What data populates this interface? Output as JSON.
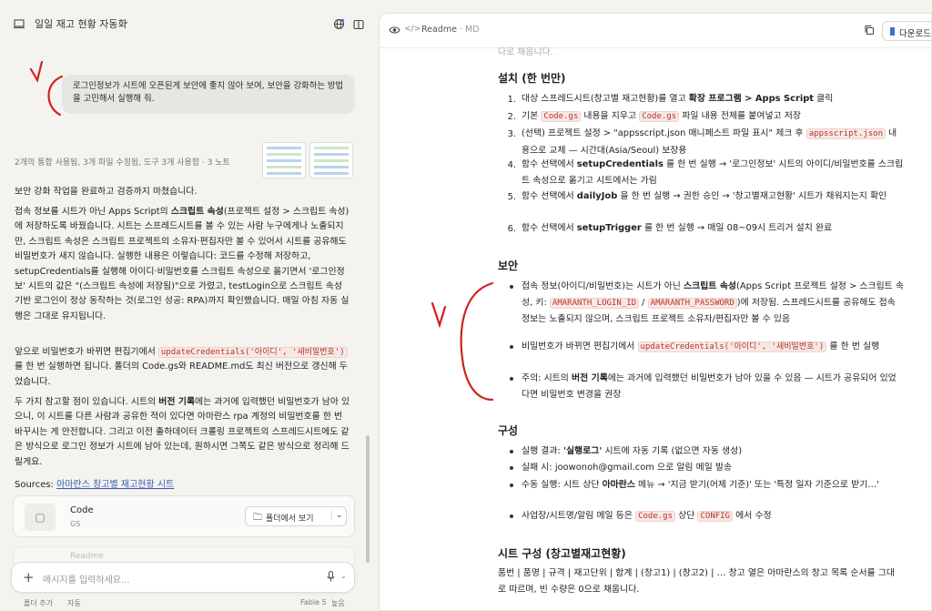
{
  "left": {
    "chat_title": "일일 재고 현황 자동화",
    "user_message": "로그인정보가 시트에 오픈된게 보안에 좋지 않아 보여, 보안을 강화하는 방법을 고민해서 실행해 줘.",
    "meta": "2개의 통합 사용됨, 3개 파일 수정됨, 도구 3개 사용함 · 3 노트",
    "p1": "보안 강화 작업을 완료하고 검증까지 마쳤습니다.",
    "p2a": "접속 정보를 시트가 아닌 Apps Script의 ",
    "p2b": "스크립트 속성",
    "p2c": "(프로젝트 설정 > 스크립트 속성)에 저장하도록 바꿨습니다. 시트는 스프레드시트를 볼 수 있는 사람 누구에게나 노출되지만, 스크립트 속성은 스크립트 프로젝트의 소유자·편집자만 볼 수 있어서 시트를 공유해도 비밀번호가 새지 않습니다. 실행한 내용은 이렇습니다: 코드를 수정해 저장하고, setupCredentials를 실행해 아이디·비밀번호를 스크립트 속성으로 옮기면서 '로그인정보' 시트의 값은 \"(스크립트 속성에 저장됨)\"으로 가렸고, testLogin으로 스크립트 속성 기반 로그인이 정상 동작하는 것(로그인 성공: RPA)까지 확인했습니다. 매일 아침 자동 실행은 그대로 유지됩니다.",
    "p3a": "앞으로 비밀번호가 바뀌면 편집기에서 ",
    "p3code": "updateCredentials('아이디', '새비밀번호')",
    "p3b": " 를 한 번 실행하면 됩니다. 폴더의 Code.gs와 README.md도 최신 버전으로 갱신해 두었습니다.",
    "p4a": "두 가지 참고할 점이 있습니다. 시트의 ",
    "p4b": "버전 기록",
    "p4c": "에는 과거에 입력했던 비밀번호가 남아 있으니, 이 시트를 다른 사람과 공유한 적이 있다면 아마란스 rpa 계정의 비밀번호를 한 번 바꾸시는 게 안전합니다. 그리고 이전 출하데이터 크롤링 프로젝트의 스프레드시트에도 같은 방식으로 로그인 정보가 시트에 남아 있는데, 원하시면 그쪽도 같은 방식으로 정리해 드릴게요.",
    "sources_label": "Sources: ",
    "sources_link": "아마란스 창고별 재고현황 시트",
    "file_name": "Code",
    "file_type": "GS",
    "folder_btn": "폴더에서 보기",
    "file2_name": "Readme",
    "input_placeholder": "메시지를 입력하세요...",
    "bottom_add": "폴더 추가",
    "bottom_auto": "자동",
    "model": "Fable 5",
    "effort": "높음"
  },
  "right": {
    "doc_name": "Readme",
    "doc_ext": "· MD",
    "download": "다운로드",
    "cut_text": "다로 채웁니다.",
    "h_install": "설치 (한 번만)",
    "install": [
      {
        "n": "1.",
        "parts": [
          "대상 스프레드시트(창고별 재고현황)를 열고 ",
          {
            "b": "확장 프로그램 > Apps Script"
          },
          " 클릭"
        ]
      },
      {
        "n": "2.",
        "parts": [
          "기본 ",
          {
            "c": "Code.gs"
          },
          " 내용을 지우고 ",
          {
            "c": "Code.gs"
          },
          " 파일 내용 전체를 붙여넣고 저장"
        ]
      },
      {
        "n": "3.",
        "parts": [
          "(선택) 프로젝트 설정 > \"appsscript.json 매니페스트 파일 표시\" 체크 후 ",
          {
            "c": "appsscript.json"
          },
          " 내용으로 교체 — 시간대(Asia/Seoul) 보장용"
        ]
      },
      {
        "n": "4.",
        "parts": [
          "함수 선택에서 ",
          {
            "b": "setupCredentials"
          },
          " 를 한 번 실행 → '로그인정보' 시트의 아이디/비밀번호를 스크립트 속성으로 옮기고 시트에서는 가림"
        ]
      },
      {
        "n": "5.",
        "parts": [
          "함수 선택에서 ",
          {
            "b": "dailyJob"
          },
          " 을 한 번 실행 → 권한 승인 → '창고별재고현황' 시트가 채워지는지 확인"
        ]
      },
      {
        "n": "6.",
        "parts": [
          "함수 선택에서 ",
          {
            "b": "setupTrigger"
          },
          " 를 한 번 실행 → 매일 08~09시 트리거 설치 완료"
        ]
      }
    ],
    "h_security": "보안",
    "security": [
      {
        "parts": [
          "접속 정보(아이디/비밀번호)는 시트가 아닌 ",
          {
            "b": "스크립트 속성"
          },
          "(Apps Script 프로젝트 설정 > 스크립트 속성, 키: ",
          {
            "c": "AMARANTH_LOGIN_ID"
          },
          " / ",
          {
            "c": "AMARANTH_PASSWORD"
          },
          ")에 저장됨. 스프레드시트를 공유해도 접속 정보는 노출되지 않으며, 스크립트 프로젝트 소유자/편집자만 볼 수 있음"
        ]
      },
      {
        "parts": [
          "비밀번호가 바뀌면 편집기에서 ",
          {
            "c": "updateCredentials('아이디', '새비밀번호')"
          },
          " 를 한 번 실행"
        ]
      },
      {
        "parts": [
          "주의: 시트의 ",
          {
            "b": "버전 기록"
          },
          "에는 과거에 입력했던 비밀번호가 남아 있을 수 있음 — 시트가 공유되어 있었다면 비밀번호 변경을 권장"
        ]
      }
    ],
    "h_structure": "구성",
    "structure": [
      {
        "parts": [
          "실행 결과: ",
          {
            "b": "'실행로그'"
          },
          " 시트에 자동 기록 (없으면 자동 생성)"
        ]
      },
      {
        "parts": [
          "실패 시: joowonoh@gmail.com 으로 알림 메일 발송"
        ]
      },
      {
        "parts": [
          "수동 실행: 시트 상단 ",
          {
            "b": "아마란스"
          },
          " 메뉴 → '지금 받기(어제 기준)' 또는 '특정 일자 기준으로 받기…'"
        ]
      },
      {
        "parts": [
          "사업장/시트명/알림 메일 등은 ",
          {
            "c": "Code.gs"
          },
          " 상단 ",
          {
            "c": "CONFIG"
          },
          " 에서 수정"
        ]
      }
    ],
    "h_sheet": "시트 구성 (창고별재고현황)",
    "sheet_text": "품번 | 품명 | 규격 | 재고단위 | 합계 | (창고1) | (창고2) | … 창고 열은 아마란스의 창고 목록 순서를 그대로 따르며, 빈 수량은 0으로 채웁니다."
  },
  "colors": {
    "annotation": "#d0221e",
    "accent": "#3b6fd8",
    "link": "#3a5bb0"
  }
}
